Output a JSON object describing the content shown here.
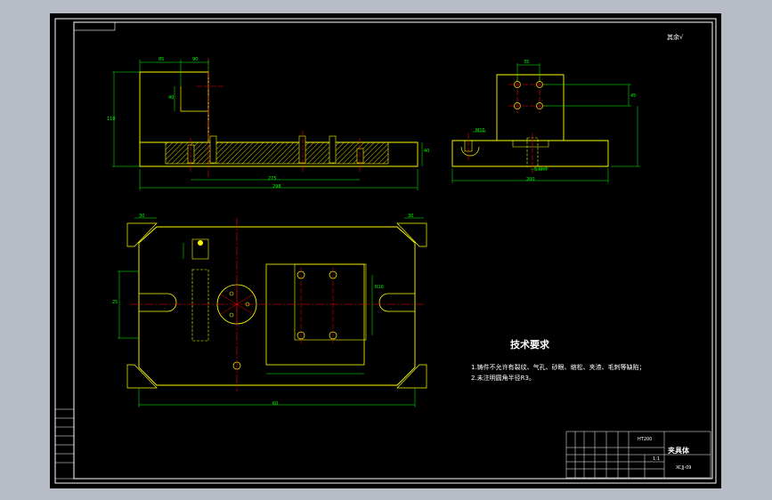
{
  "roughness_note": "其余√",
  "tech_requirements": {
    "title": "技术要求",
    "notes": [
      "1.铸件不允许有裂纹、气孔、砂眼、缩松、夹渣、毛刺等缺陷；",
      "2.未注明圆角半径R3。"
    ]
  },
  "title_block": {
    "part_name": "夹具体",
    "material": "HT200",
    "drawing_no": "XCJJ-09",
    "scale": "1:1"
  },
  "dimensions": {
    "front_view": [
      "85",
      "90",
      "40",
      "110",
      "40",
      "R5",
      "R6",
      "275",
      "298",
      "20"
    ],
    "side_view": [
      "35",
      "M10",
      "10",
      "65",
      "200",
      "45",
      "R10",
      "45",
      "5.6H7",
      "32",
      "M10"
    ],
    "top_view": [
      "30",
      "10",
      "15",
      "30",
      "Ø30",
      "R10",
      "30",
      "30",
      "60",
      "25",
      "Ø3"
    ]
  },
  "colors": {
    "sheet": "#000000",
    "frame": "#ffffff",
    "outline": "#ffff00",
    "dimension": "#00ff00",
    "centerline": "#ff0000",
    "hatch": "#ffff00",
    "hidden": "#ffff00",
    "text": "#ffffff"
  }
}
